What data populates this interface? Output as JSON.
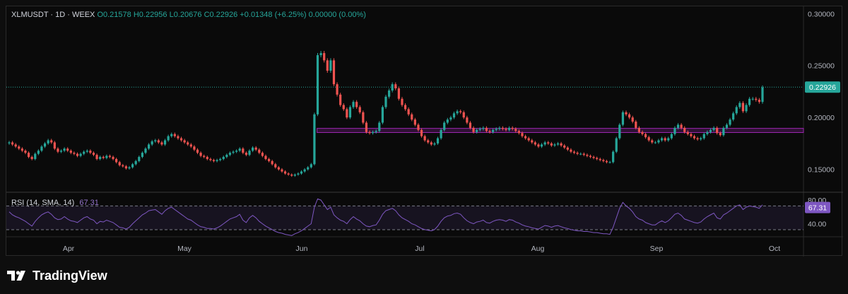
{
  "legend": {
    "symbol": "XLMUSDT · 1D · WEEX",
    "open": "O0.21578",
    "high": "H0.22956",
    "low": "L0.20676",
    "close": "C0.22926",
    "change": "+0.01348 (+6.25%)",
    "volume": "0.00000 (0.00%)"
  },
  "rsi_legend": {
    "label": "RSI (14, SMA, 14)",
    "value": "67.31"
  },
  "branding": {
    "name": "TradingView"
  },
  "colors": {
    "up": "#26a69a",
    "down": "#ef5350",
    "rsi": "#7e57c2",
    "zone": "#9c27b0",
    "price_label_bg": "#26a69a",
    "rsi_label_bg": "#7e57c2"
  },
  "chart_data": [
    {
      "type": "candlestick",
      "x_tick_labels": [
        "Apr",
        "May",
        "Jun",
        "Jul",
        "Aug",
        "Sep",
        "Oct"
      ],
      "y_tick_labels": [
        "0.30000",
        "0.25000",
        "0.20000",
        "0.15000"
      ],
      "ylim": [
        0.128,
        0.307
      ],
      "current_price_label": "0.22926",
      "current_price": 0.22926,
      "support_zone": {
        "from": 0.1855,
        "to": 0.1895,
        "start": "Jun"
      },
      "closes": [
        0.176,
        0.174,
        0.172,
        0.17,
        0.168,
        0.166,
        0.162,
        0.16,
        0.165,
        0.168,
        0.172,
        0.175,
        0.178,
        0.176,
        0.17,
        0.167,
        0.168,
        0.17,
        0.168,
        0.166,
        0.165,
        0.163,
        0.165,
        0.167,
        0.168,
        0.166,
        0.164,
        0.16,
        0.162,
        0.161,
        0.163,
        0.162,
        0.16,
        0.157,
        0.154,
        0.153,
        0.151,
        0.152,
        0.155,
        0.158,
        0.162,
        0.166,
        0.17,
        0.174,
        0.177,
        0.178,
        0.176,
        0.174,
        0.178,
        0.182,
        0.184,
        0.182,
        0.18,
        0.178,
        0.176,
        0.174,
        0.172,
        0.169,
        0.166,
        0.163,
        0.162,
        0.16,
        0.159,
        0.158,
        0.159,
        0.16,
        0.162,
        0.164,
        0.166,
        0.167,
        0.168,
        0.17,
        0.166,
        0.164,
        0.168,
        0.171,
        0.169,
        0.166,
        0.163,
        0.16,
        0.158,
        0.155,
        0.152,
        0.15,
        0.148,
        0.146,
        0.145,
        0.144,
        0.145,
        0.146,
        0.148,
        0.15,
        0.152,
        0.155,
        0.203,
        0.26,
        0.262,
        0.255,
        0.245,
        0.255,
        0.232,
        0.222,
        0.212,
        0.208,
        0.2,
        0.21,
        0.215,
        0.21,
        0.205,
        0.195,
        0.186,
        0.185,
        0.186,
        0.187,
        0.195,
        0.21,
        0.22,
        0.226,
        0.232,
        0.228,
        0.218,
        0.212,
        0.208,
        0.203,
        0.198,
        0.193,
        0.188,
        0.182,
        0.178,
        0.176,
        0.174,
        0.175,
        0.18,
        0.188,
        0.195,
        0.198,
        0.2,
        0.204,
        0.206,
        0.205,
        0.2,
        0.195,
        0.19,
        0.186,
        0.188,
        0.189,
        0.19,
        0.187,
        0.186,
        0.188,
        0.189,
        0.19,
        0.189,
        0.188,
        0.19,
        0.189,
        0.187,
        0.185,
        0.182,
        0.18,
        0.178,
        0.176,
        0.174,
        0.172,
        0.174,
        0.176,
        0.175,
        0.173,
        0.174,
        0.175,
        0.173,
        0.171,
        0.169,
        0.167,
        0.166,
        0.165,
        0.165,
        0.164,
        0.163,
        0.162,
        0.161,
        0.16,
        0.159,
        0.158,
        0.157,
        0.157,
        0.167,
        0.18,
        0.193,
        0.205,
        0.203,
        0.2,
        0.196,
        0.19,
        0.186,
        0.184,
        0.181,
        0.178,
        0.176,
        0.176,
        0.178,
        0.18,
        0.178,
        0.18,
        0.184,
        0.19,
        0.193,
        0.19,
        0.186,
        0.184,
        0.182,
        0.18,
        0.179,
        0.18,
        0.184,
        0.186,
        0.188,
        0.19,
        0.185,
        0.183,
        0.19,
        0.193,
        0.198,
        0.204,
        0.21,
        0.214,
        0.206,
        0.212,
        0.218,
        0.218,
        0.217,
        0.215,
        0.229
      ]
    },
    {
      "type": "line",
      "name": "RSI (14, SMA, 14)",
      "ylim": [
        18,
        92
      ],
      "y_tick_labels": [
        "80.00",
        "40.00"
      ],
      "bands": [
        70,
        30
      ],
      "current_value_label": "67.31",
      "values": [
        60,
        55,
        52,
        50,
        47,
        44,
        40,
        36,
        44,
        50,
        55,
        58,
        60,
        56,
        50,
        47,
        48,
        52,
        48,
        45,
        44,
        42,
        46,
        50,
        52,
        48,
        46,
        40,
        44,
        43,
        46,
        44,
        42,
        38,
        34,
        33,
        31,
        34,
        40,
        45,
        50,
        55,
        58,
        62,
        63,
        64,
        60,
        56,
        62,
        66,
        68,
        64,
        60,
        56,
        52,
        48,
        46,
        42,
        38,
        35,
        34,
        32,
        32,
        31,
        33,
        36,
        40,
        44,
        48,
        50,
        52,
        56,
        46,
        42,
        50,
        54,
        50,
        44,
        40,
        36,
        33,
        30,
        27,
        25,
        24,
        22,
        21,
        20,
        23,
        25,
        28,
        32,
        36,
        40,
        68,
        82,
        80,
        72,
        64,
        68,
        55,
        50,
        46,
        44,
        40,
        47,
        52,
        48,
        45,
        40,
        36,
        35,
        37,
        38,
        46,
        56,
        62,
        64,
        66,
        62,
        55,
        50,
        47,
        44,
        40,
        38,
        35,
        32,
        30,
        29,
        28,
        30,
        36,
        44,
        50,
        53,
        54,
        57,
        58,
        56,
        50,
        45,
        42,
        40,
        43,
        44,
        46,
        42,
        41,
        44,
        46,
        47,
        46,
        44,
        47,
        46,
        43,
        41,
        38,
        36,
        35,
        33,
        32,
        31,
        34,
        37,
        36,
        34,
        36,
        37,
        35,
        33,
        32,
        30,
        29,
        28,
        28,
        27,
        27,
        26,
        25,
        25,
        24,
        23,
        23,
        22,
        34,
        50,
        66,
        76,
        70,
        66,
        60,
        52,
        48,
        46,
        42,
        40,
        38,
        38,
        42,
        45,
        42,
        45,
        50,
        56,
        58,
        54,
        48,
        46,
        44,
        42,
        41,
        43,
        48,
        52,
        55,
        58,
        50,
        48,
        55,
        58,
        62,
        66,
        70,
        72,
        64,
        68,
        70,
        69,
        68,
        66,
        72
      ]
    }
  ]
}
